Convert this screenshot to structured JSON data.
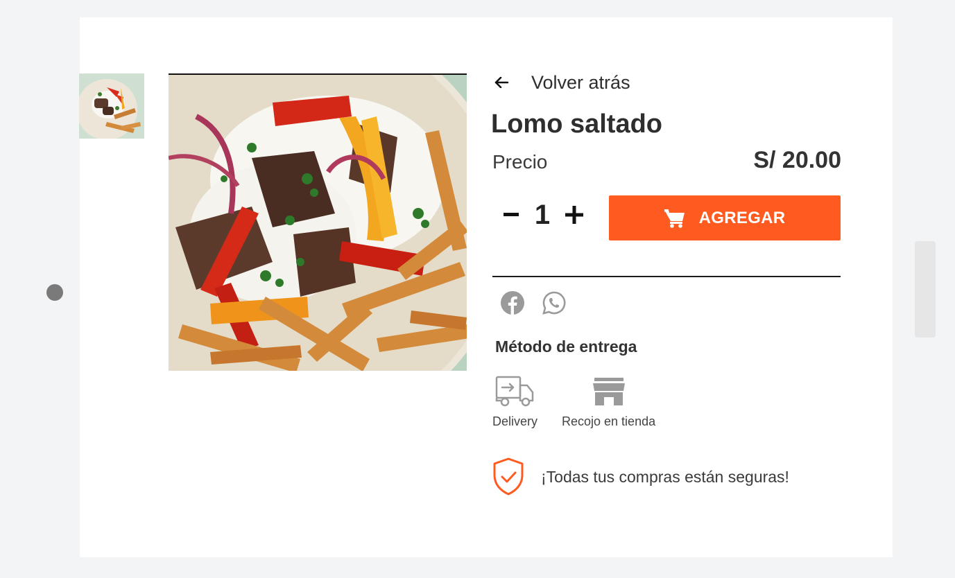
{
  "product": {
    "back_label": "Volver atrás",
    "name": "Lomo saltado",
    "price_label": "Precio",
    "price_value": "S/ 20.00",
    "quantity": "1",
    "minus_label": "–",
    "plus_label": "+",
    "add_button_label": "AGREGAR"
  },
  "share": {
    "icons": [
      "facebook-icon",
      "whatsapp-icon"
    ]
  },
  "delivery": {
    "title": "Método de entrega",
    "options": [
      {
        "label": "Delivery",
        "icon": "delivery-truck-icon"
      },
      {
        "label": "Recojo en tienda",
        "icon": "store-icon"
      }
    ]
  },
  "security": {
    "text": "¡Todas tus compras están seguras!"
  },
  "colors": {
    "accent": "#ff5a1f",
    "icon_gray": "#9a9a9a"
  }
}
